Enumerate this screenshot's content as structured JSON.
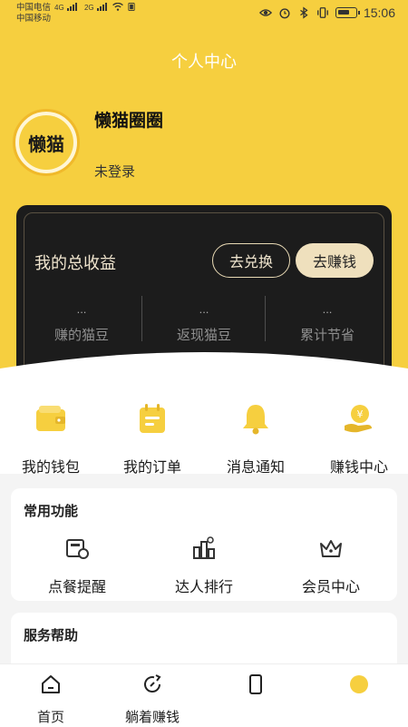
{
  "status_bar": {
    "carrier1": "中国电信",
    "carrier2": "中国移动",
    "net1": "4G",
    "net2": "2G",
    "time": "15:06"
  },
  "header": {
    "title": "个人中心"
  },
  "profile": {
    "avatar_text": "懒猫",
    "name": "懒猫圈圈",
    "status": "未登录"
  },
  "earnings": {
    "title": "我的总收益",
    "exchange_label": "去兑换",
    "earn_label": "去赚钱",
    "stats": [
      {
        "value": "...",
        "label": "赚的猫豆"
      },
      {
        "value": "...",
        "label": "返现猫豆"
      },
      {
        "value": "...",
        "label": "累计节省"
      }
    ]
  },
  "quick_actions": [
    {
      "label": "我的钱包",
      "icon": "wallet-icon"
    },
    {
      "label": "我的订单",
      "icon": "order-icon"
    },
    {
      "label": "消息通知",
      "icon": "bell-icon"
    },
    {
      "label": "赚钱中心",
      "icon": "earn-center-icon"
    }
  ],
  "common_functions": {
    "title": "常用功能",
    "items": [
      {
        "label": "点餐提醒",
        "icon": "meal-reminder-icon"
      },
      {
        "label": "达人排行",
        "icon": "ranking-icon"
      },
      {
        "label": "会员中心",
        "icon": "crown-icon"
      }
    ]
  },
  "service_help": {
    "title": "服务帮助"
  },
  "tabbar": [
    {
      "label": "首页",
      "icon": "home-icon"
    },
    {
      "label": "躺着赚钱",
      "icon": "earn-tab-icon"
    }
  ],
  "colors": {
    "brand_yellow": "#f6cf3f",
    "card_dark": "#1c1c1c",
    "accent_gold": "#efe0bd"
  }
}
